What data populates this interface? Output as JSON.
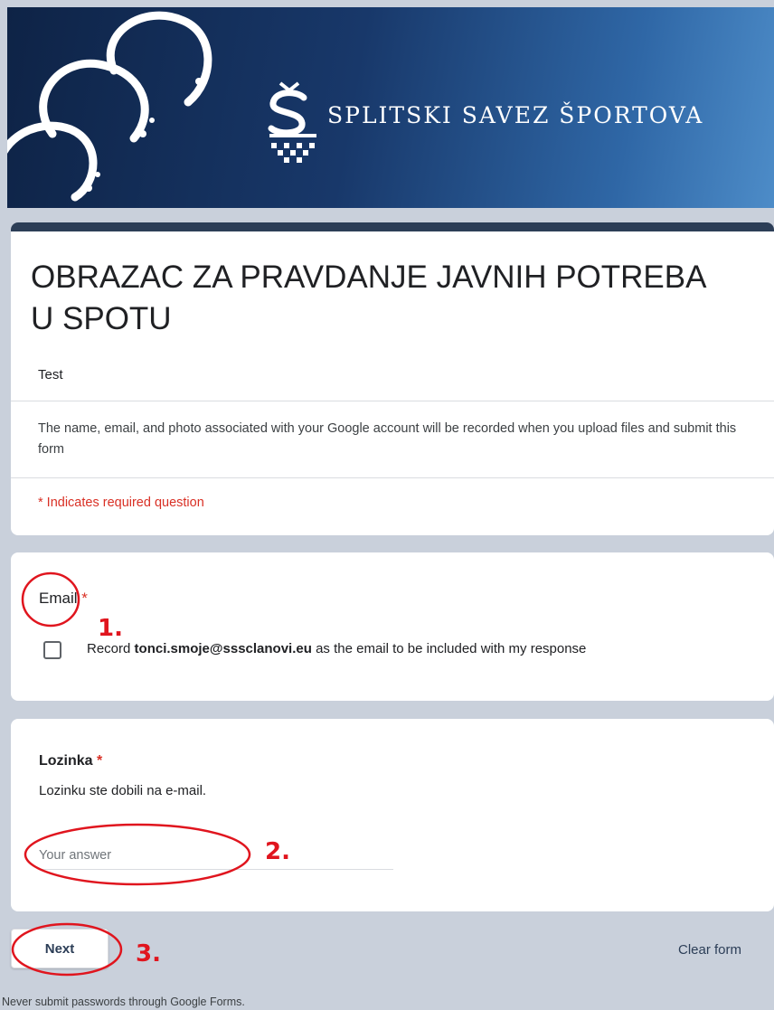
{
  "header": {
    "brand_name": "SPLITSKI SAVEZ ŠPORTOVA"
  },
  "form": {
    "title": "OBRAZAC ZA PRAVDANJE JAVNIH POTREBA U SPOTU",
    "description": "Test",
    "account_notice": "The name, email, and photo associated with your Google account will be recorded when you upload files and submit this form",
    "required_note": "* Indicates required question"
  },
  "email_question": {
    "label": "Email",
    "required_marker": "*",
    "checkbox_checked": false,
    "record_prefix": "Record ",
    "record_email": "tonci.smoje@sssclanovi.eu",
    "record_suffix": " as the email to be included with my response"
  },
  "password_question": {
    "label": "Lozinka",
    "required_marker": "*",
    "help_text": "Lozinku ste dobili na e-mail.",
    "placeholder": "Your answer",
    "value": ""
  },
  "actions": {
    "next_label": "Next",
    "clear_label": "Clear form"
  },
  "footer": {
    "warning": "Never submit passwords through Google Forms."
  },
  "annotations": [
    {
      "label": "1."
    },
    {
      "label": "2."
    },
    {
      "label": "3."
    }
  ],
  "colors": {
    "accent": "#2c3e57",
    "required": "#d93025",
    "annotation": "#e0151e",
    "page_background": "#c9d0db"
  }
}
